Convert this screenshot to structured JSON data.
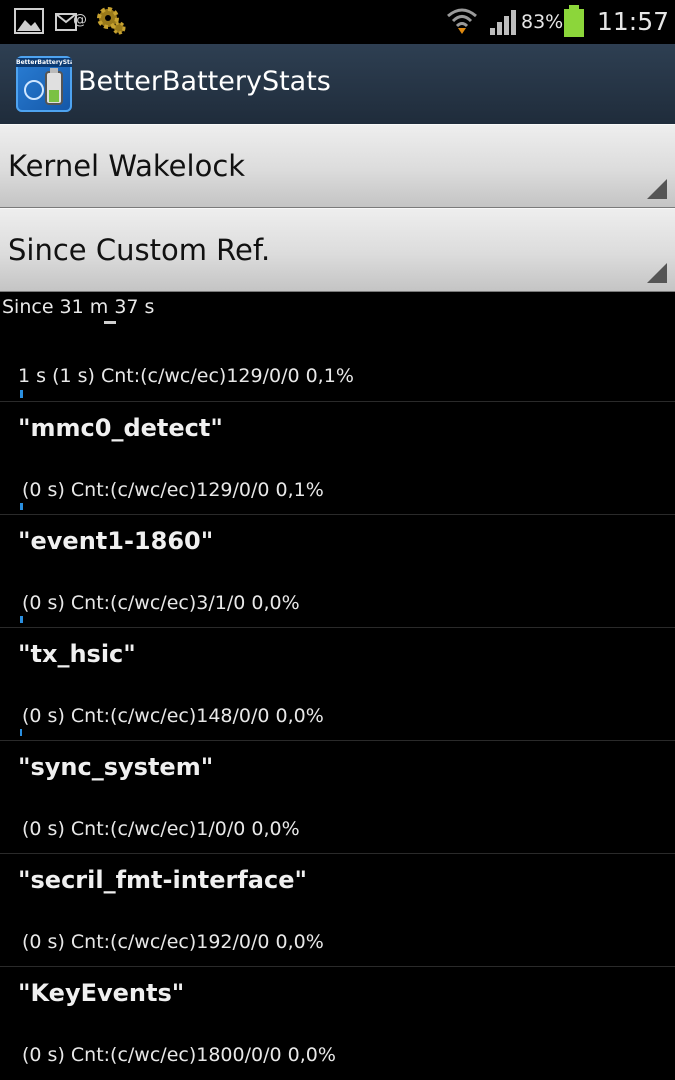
{
  "status_bar": {
    "battery_percent": "83%",
    "time": "11:57",
    "icons": [
      "gallery-icon",
      "email-icon",
      "settings-gear-icon",
      "wifi-icon",
      "signal-icon",
      "battery-icon"
    ]
  },
  "action_bar": {
    "app_icon_text": "BetterBatteryStats",
    "title": "BetterBatteryStats"
  },
  "stat_type_spinner": {
    "selected": "Kernel Wakelock"
  },
  "reference_spinner": {
    "selected": "Since Custom Ref."
  },
  "since_label": "Since 31 m 37 s",
  "first_item": {
    "stats": "1 s  (1 s) Cnt:(c/wc/ec)129/0/0 0,1%"
  },
  "wakelocks": [
    {
      "name": "\"mmc0_detect\"",
      "stats": "(0 s) Cnt:(c/wc/ec)129/0/0 0,1%",
      "bar_fraction": 0.01
    },
    {
      "name": "\"event1-1860\"",
      "stats": "(0 s) Cnt:(c/wc/ec)3/1/0 0,0%",
      "bar_fraction": 0.005
    },
    {
      "name": "\"tx_hsic\"",
      "stats": "(0 s) Cnt:(c/wc/ec)148/0/0 0,0%",
      "bar_fraction": 0.003
    },
    {
      "name": "\"sync_system\"",
      "stats": "(0 s) Cnt:(c/wc/ec)1/0/0 0,0%",
      "bar_fraction": 0
    },
    {
      "name": "\"secril_fmt-interface\"",
      "stats": "(0 s) Cnt:(c/wc/ec)192/0/0 0,0%",
      "bar_fraction": 0
    },
    {
      "name": "\"KeyEvents\"",
      "stats": "(0 s) Cnt:(c/wc/ec)1800/0/0 0,0%",
      "bar_fraction": 0
    }
  ],
  "colors": {
    "accent": "#2a8fe0",
    "action_bar": "#263545"
  }
}
